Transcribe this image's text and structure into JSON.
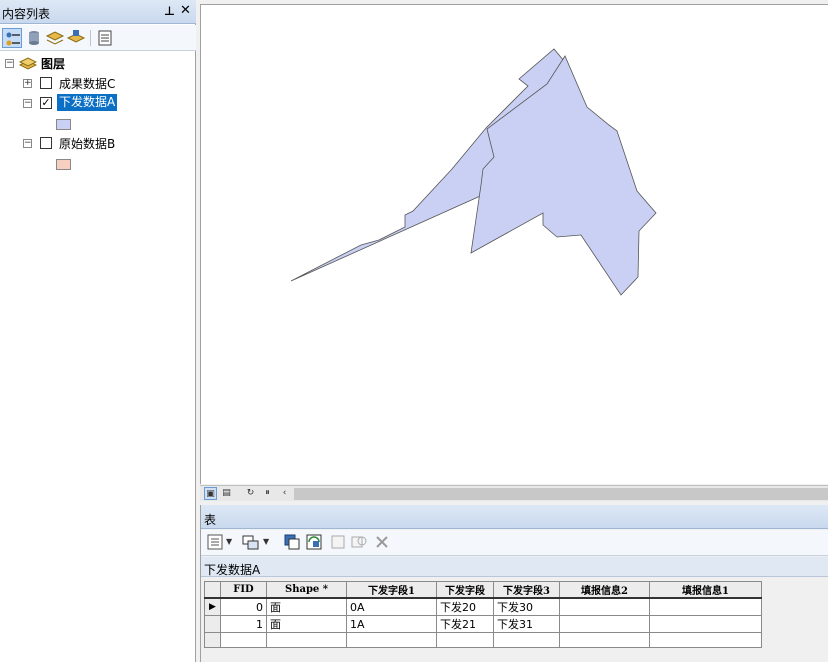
{
  "toc": {
    "title": "内容列表",
    "pin_glyph": "↑",
    "close_glyph": "✕",
    "toolbar": [
      "list-by-drawing-order-icon",
      "list-by-source-icon",
      "list-by-visibility-icon",
      "list-by-selection-icon",
      "options-icon"
    ],
    "root": {
      "label": "图层",
      "expander": "−"
    },
    "layers": [
      {
        "label": "成果数据C",
        "expander": "+",
        "checked": false,
        "selected": false
      },
      {
        "label": "下发数据A",
        "expander": "−",
        "checked": true,
        "selected": true,
        "swatch_color": "#c9d0f3"
      },
      {
        "label": "原始数据B",
        "expander": "−",
        "checked": false,
        "selected": false,
        "swatch_color": "#f6cfc0"
      }
    ]
  },
  "map": {
    "fill_color": "#c9d0f3",
    "stroke_color": "#555555"
  },
  "map_bar": {
    "buttons": [
      "data-view-icon",
      "layout-view-icon",
      "refresh-icon",
      "pause-icon",
      "scroll-left-icon"
    ]
  },
  "table_panel": {
    "title": "表",
    "layer_name": "下发数据A",
    "toolbar": [
      "table-options-icon",
      "related-tables-icon",
      "select-by-attributes-icon",
      "switch-selection-icon",
      "clear-selection-icon",
      "zoom-to-selected-icon",
      "delete-selected-icon"
    ],
    "columns": [
      "FID",
      "Shape *",
      "下发字段1",
      "下发字段",
      "下发字段3",
      "填报信息2",
      "填报信息1"
    ],
    "rows": [
      {
        "current": true,
        "cells": [
          "0",
          "面",
          "0A",
          "下发20",
          "下发30",
          "",
          ""
        ]
      },
      {
        "current": false,
        "cells": [
          "1",
          "面",
          "1A",
          "下发21",
          "下发31",
          "",
          ""
        ]
      }
    ]
  }
}
